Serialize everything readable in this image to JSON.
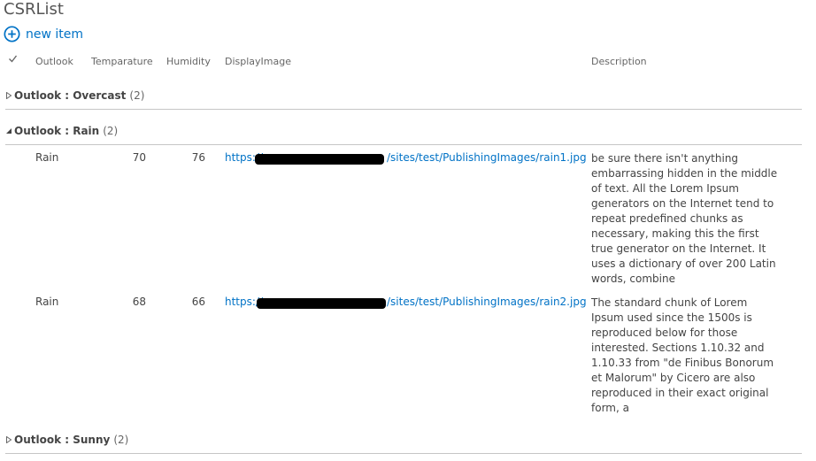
{
  "list": {
    "title": "CSRList",
    "new_item_label": "new item"
  },
  "columns": [
    "Outlook",
    "Temparature",
    "Humidity",
    "DisplayImage",
    "Description"
  ],
  "groups": [
    {
      "label": "Outlook : Overcast",
      "count": "(2)"
    },
    {
      "label": "Outlook : Rain",
      "count": "(2)"
    },
    {
      "label": "Outlook : Sunny",
      "count": "(2)"
    }
  ],
  "rows": [
    {
      "outlook": "Rain",
      "temperature": "70",
      "humidity": "76",
      "url_prefix": "https://",
      "url_suffix": "/sites/test/PublishingImages/rain1.jpg",
      "description": "be sure there isn't anything embarrassing hidden in the middle of text. All the Lorem Ipsum generators on the Internet tend to repeat predefined chunks as necessary, making this the first true generator on the Internet. It uses a dictionary of over 200 Latin words, combine"
    },
    {
      "outlook": "Rain",
      "temperature": "68",
      "humidity": "66",
      "url_prefix": "https://",
      "url_suffix": "/sites/test/PublishingImages/rain2.jpg",
      "description": "The standard chunk of Lorem Ipsum used since the 1500s is reproduced below for those interested. Sections 1.10.32 and 1.10.33 from \"de Finibus Bonorum et Malorum\" by Cicero are also reproduced in their exact original form, a"
    }
  ],
  "colors": {
    "link": "#0072c6",
    "text": "#444444",
    "divider": "#c6c6c6"
  },
  "icons": {
    "add": "plus-circle-icon",
    "select": "checkmark-icon",
    "collapsed": "triangle-right-icon",
    "expanded": "triangle-down-icon"
  }
}
